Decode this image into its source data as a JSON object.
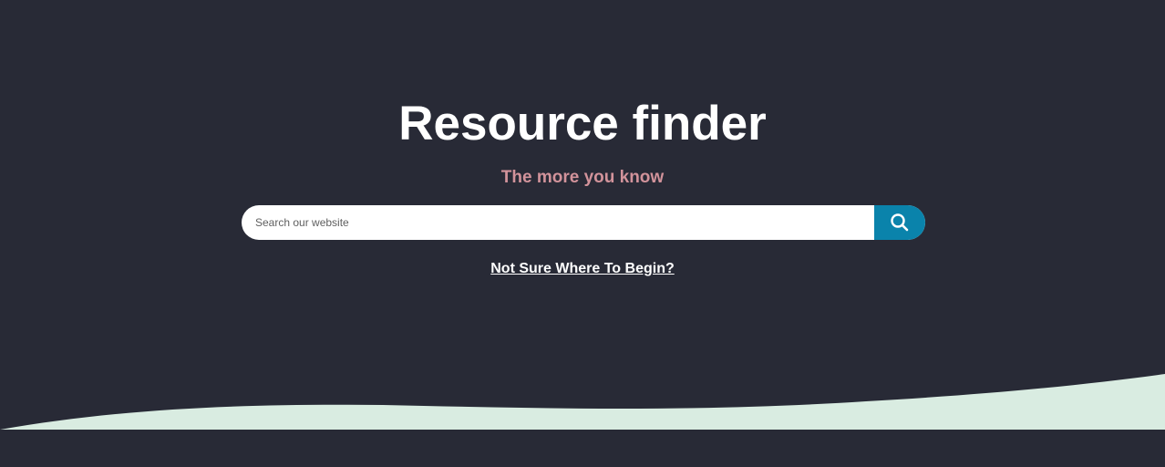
{
  "hero": {
    "title": "Resource finder",
    "subtitle": "The more you know",
    "help_link": "Not Sure Where To Begin?"
  },
  "search": {
    "placeholder": "Search our website",
    "value": "",
    "button_icon": "search-icon"
  },
  "colors": {
    "background": "#282a36",
    "title": "#ffffff",
    "subtitle": "#d2939b",
    "search_button": "#0a83ab",
    "wave": "#d9ece1"
  }
}
